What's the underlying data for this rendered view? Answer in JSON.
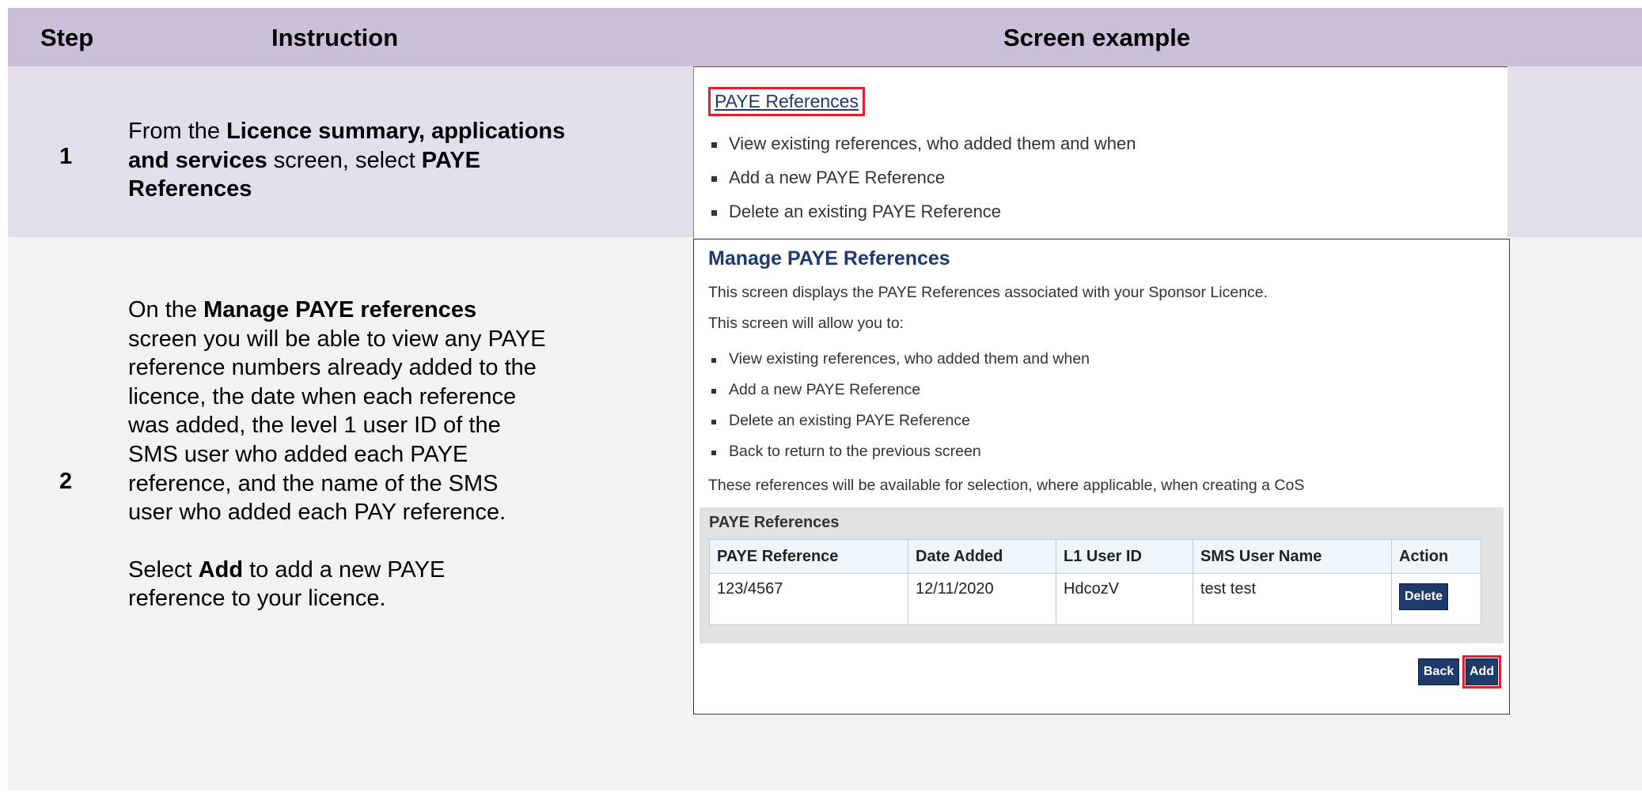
{
  "headers": {
    "step": "Step",
    "instruction": "Instruction",
    "screen": "Screen example"
  },
  "rows": [
    {
      "step": "1",
      "instruction": {
        "p1_a": "From the ",
        "p1_b": "Licence summary, applications and services",
        "p1_c": " screen, select ",
        "p1_d": "PAYE References"
      },
      "screen": {
        "link": "PAYE References",
        "bullets": [
          "View existing references, who added them and when",
          "Add a new PAYE Reference",
          "Delete an existing PAYE Reference"
        ]
      }
    },
    {
      "step": "2",
      "instruction": {
        "p1_a": "On the ",
        "p1_b": "Manage PAYE references",
        "p1_c": " screen you will be able to view any PAYE reference numbers already added to the licence, the date when each reference was added, the level 1 user ID of the SMS user who added each PAYE reference, and the name of the SMS user who added each PAY reference.",
        "p2_a": "Select ",
        "p2_b": "Add",
        "p2_c": " to add a new PAYE reference to your licence."
      },
      "screen": {
        "title": "Manage PAYE References",
        "intro1": "This screen displays the PAYE References associated with your Sponsor Licence.",
        "intro2": "This screen will allow you to:",
        "bullets": [
          "View existing references, who added them and when",
          "Add a new PAYE Reference",
          "Delete an existing PAYE Reference",
          "Back to return to the previous screen"
        ],
        "note": "These references will be available for selection, where applicable, when creating a CoS",
        "panel_title": "PAYE References",
        "columns": [
          "PAYE Reference",
          "Date Added",
          "L1 User ID",
          "SMS User Name",
          "Action"
        ],
        "row": {
          "ref": "123/4567",
          "date": "12/11/2020",
          "user_id": "HdcozV",
          "user_name": "test test",
          "action": "Delete"
        },
        "back_label": "Back",
        "add_label": "Add"
      }
    }
  ],
  "colors": {
    "header_bg": "#cbbfd9",
    "row1_bg": "#e4deeb",
    "row2_bg": "#f2f2f2",
    "highlight": "#e0202a",
    "button": "#1f3b6b"
  }
}
